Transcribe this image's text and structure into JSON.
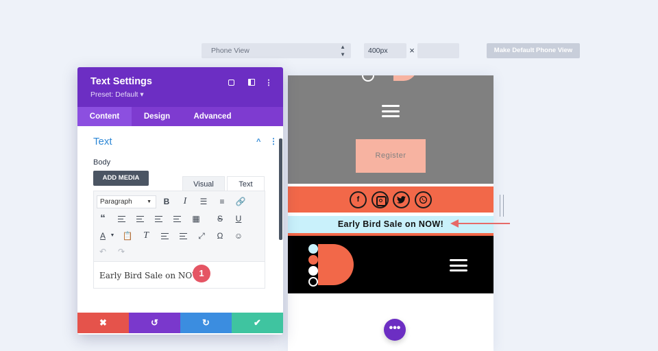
{
  "toolbar": {
    "view_select": "Phone View",
    "width_value": "400px",
    "times": "×",
    "height_value": "",
    "default_button": "Make Default Phone View"
  },
  "panel": {
    "title": "Text Settings",
    "preset": "Preset: Default ▾",
    "tabs": [
      "Content",
      "Design",
      "Advanced"
    ],
    "section_title": "Text",
    "body_label": "Body",
    "add_media": "ADD MEDIA",
    "editor_tabs": [
      "Visual",
      "Text"
    ],
    "format_select": "Paragraph",
    "editor_content": "Early Bird Sale on NOW!",
    "badge": "1",
    "footer_icons": [
      "close-icon",
      "undo-icon",
      "redo-icon",
      "check-icon"
    ]
  },
  "preview": {
    "register_button": "Register",
    "social_icons": [
      "facebook-icon",
      "instagram-icon",
      "twitter-icon",
      "whatsapp-icon"
    ],
    "sale_banner": "Early Bird Sale on NOW!",
    "fab": "•••"
  },
  "colors": {
    "purple_header": "#6c2ec3",
    "coral": "#f26849",
    "peach": "#f7b3a1",
    "light_blue": "#c9f1fb",
    "arrow": "#e66a68"
  }
}
